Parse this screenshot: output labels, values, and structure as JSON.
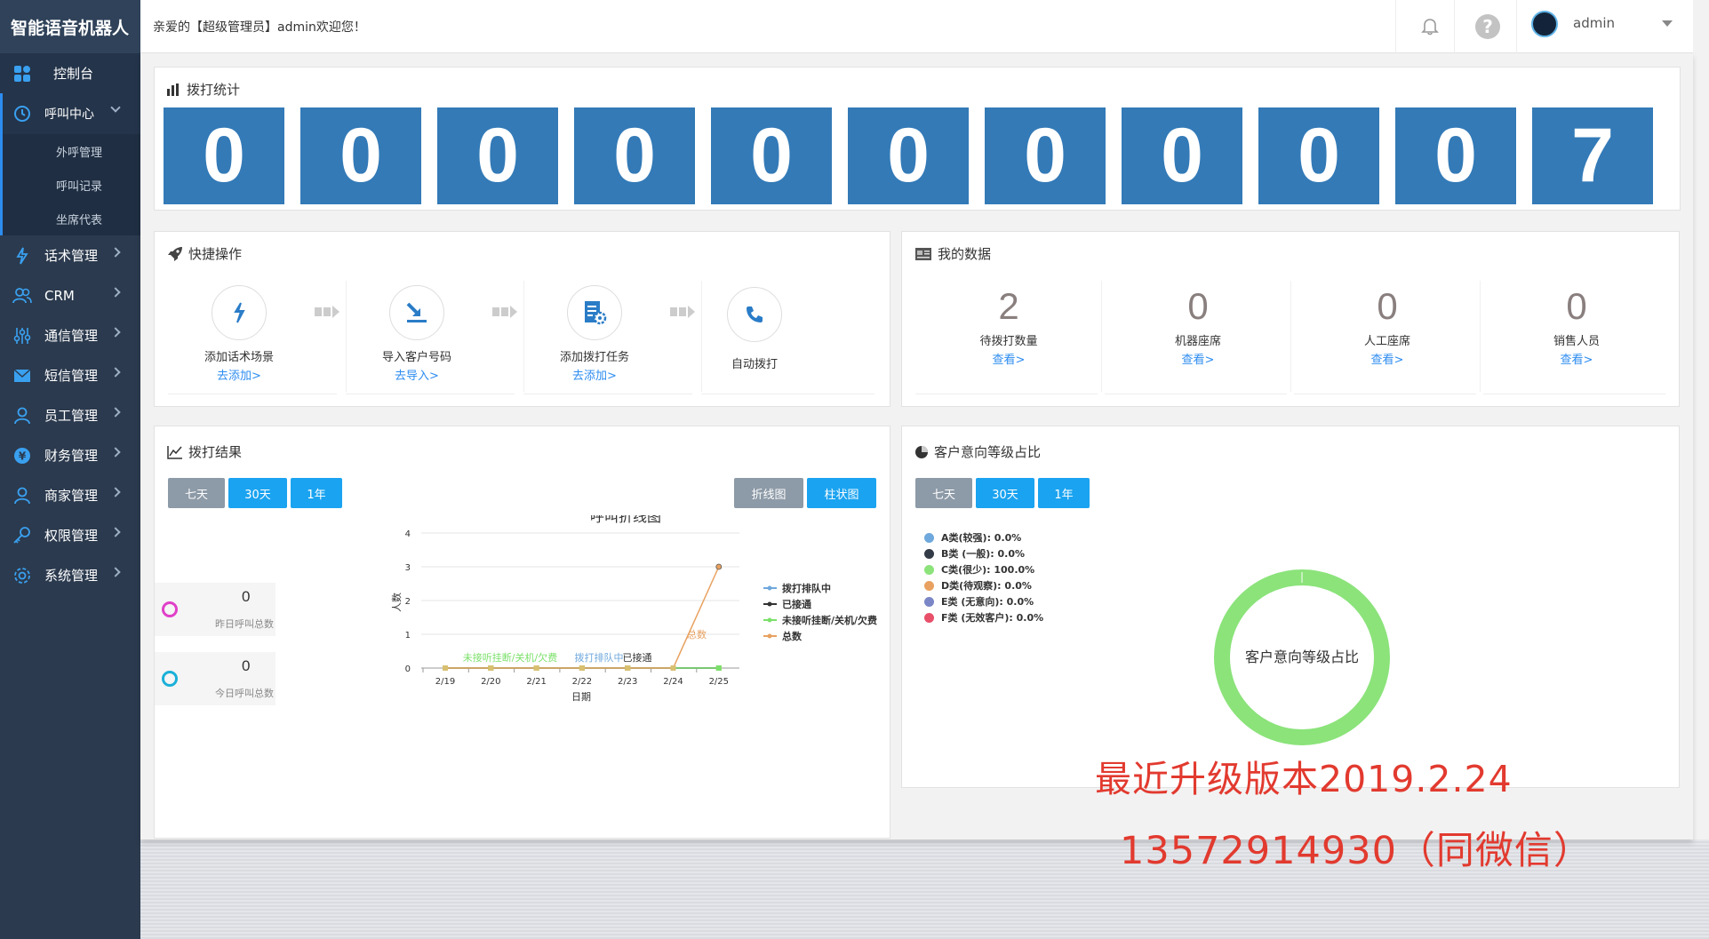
{
  "brand": "智能语音机器人",
  "topbar": {
    "welcome": "亲爱的【超级管理员】admin欢迎您！",
    "username": "admin",
    "help": "?"
  },
  "sidebar": {
    "items": [
      {
        "label": "控制台",
        "icon": "dashboard-icon"
      },
      {
        "label": "呼叫中心",
        "icon": "clock-icon"
      },
      {
        "label": "话术管理",
        "icon": "bolt-icon"
      },
      {
        "label": "CRM",
        "icon": "users-icon"
      },
      {
        "label": "通信管理",
        "icon": "sliders-icon"
      },
      {
        "label": "短信管理",
        "icon": "mail-icon"
      },
      {
        "label": "员工管理",
        "icon": "user-icon"
      },
      {
        "label": "财务管理",
        "icon": "yen-icon"
      },
      {
        "label": "商家管理",
        "icon": "user-icon"
      },
      {
        "label": "权限管理",
        "icon": "key-icon"
      },
      {
        "label": "系统管理",
        "icon": "gear-icon"
      }
    ],
    "sub_items": [
      "外呼管理",
      "呼叫记录",
      "坐席代表"
    ]
  },
  "stats": {
    "title": "拨打统计",
    "digits": [
      "0",
      "0",
      "0",
      "0",
      "0",
      "0",
      "0",
      "0",
      "0",
      "0",
      "7"
    ]
  },
  "quick_ops": {
    "title": "快捷操作",
    "items": [
      {
        "label": "添加话术场景",
        "link": "去添加>"
      },
      {
        "label": "导入客户号码",
        "link": "去导入>"
      },
      {
        "label": "添加拨打任务",
        "link": "去添加>"
      },
      {
        "label": "自动拨打",
        "link": ""
      }
    ]
  },
  "my_data": {
    "title": "我的数据",
    "items": [
      {
        "value": "2",
        "label": "待拨打数量",
        "link": "查看>"
      },
      {
        "value": "0",
        "label": "机器座席",
        "link": "查看>"
      },
      {
        "value": "0",
        "label": "人工座席",
        "link": "查看>"
      },
      {
        "value": "0",
        "label": "销售人员",
        "link": "查看>"
      }
    ]
  },
  "call_result": {
    "title": "拨打结果",
    "range_buttons": [
      "七天",
      "30天",
      "1年"
    ],
    "chart_buttons": [
      "折线图",
      "柱状图"
    ],
    "yesterday": {
      "value": "0",
      "label": "昨日呼叫总数"
    },
    "today": {
      "value": "0",
      "label": "今日呼叫总数"
    }
  },
  "chart_data": {
    "type": "line",
    "title": "呼叫折线图",
    "xlabel": "日期",
    "ylabel": "人数",
    "ylim": [
      0,
      4
    ],
    "yticks": [
      "0",
      "1",
      "2",
      "3",
      "4"
    ],
    "categories": [
      "2/19",
      "2/20",
      "2/21",
      "2/22",
      "2/23",
      "2/24",
      "2/25"
    ],
    "series": [
      {
        "name": "拨打排队中",
        "color": "#6fa8dc",
        "values": [
          0,
          0,
          0,
          0,
          0,
          0,
          0
        ]
      },
      {
        "name": "已接通",
        "color": "#333333",
        "values": [
          0,
          0,
          0,
          0,
          0,
          0,
          0
        ]
      },
      {
        "name": "未接听挂断/关机/欠费",
        "color": "#7be06a",
        "values": [
          0,
          0,
          0,
          0,
          0,
          0,
          0
        ]
      },
      {
        "name": "总数",
        "color": "#e8a160",
        "values": [
          0,
          0,
          0,
          0,
          0,
          0,
          3
        ]
      }
    ],
    "annotations": [
      "未接听挂断/关机/欠费",
      "拨打排队中",
      "已接通",
      "总数"
    ],
    "grid": true,
    "legend": "right"
  },
  "intent": {
    "title": "客户意向等级占比",
    "range_buttons": [
      "七天",
      "30天",
      "1年"
    ],
    "center_label": "客户意向等级占比",
    "legend": [
      {
        "text": "A类(较强): 0.0%",
        "color": "#6fa8dc"
      },
      {
        "text": "B类 (一般): 0.0%",
        "color": "#333b47"
      },
      {
        "text": "C类(很少): 100.0%",
        "color": "#8be37a"
      },
      {
        "text": "D类(待观察): 0.0%",
        "color": "#e8a160"
      },
      {
        "text": "E类 (无意向): 0.0%",
        "color": "#7a86c6"
      },
      {
        "text": "F类 (无效客户): 0.0%",
        "color": "#e8506a"
      }
    ]
  },
  "promo": {
    "line1": "最近升级版本2019.2.24",
    "line2": "13572914930（同微信）"
  }
}
